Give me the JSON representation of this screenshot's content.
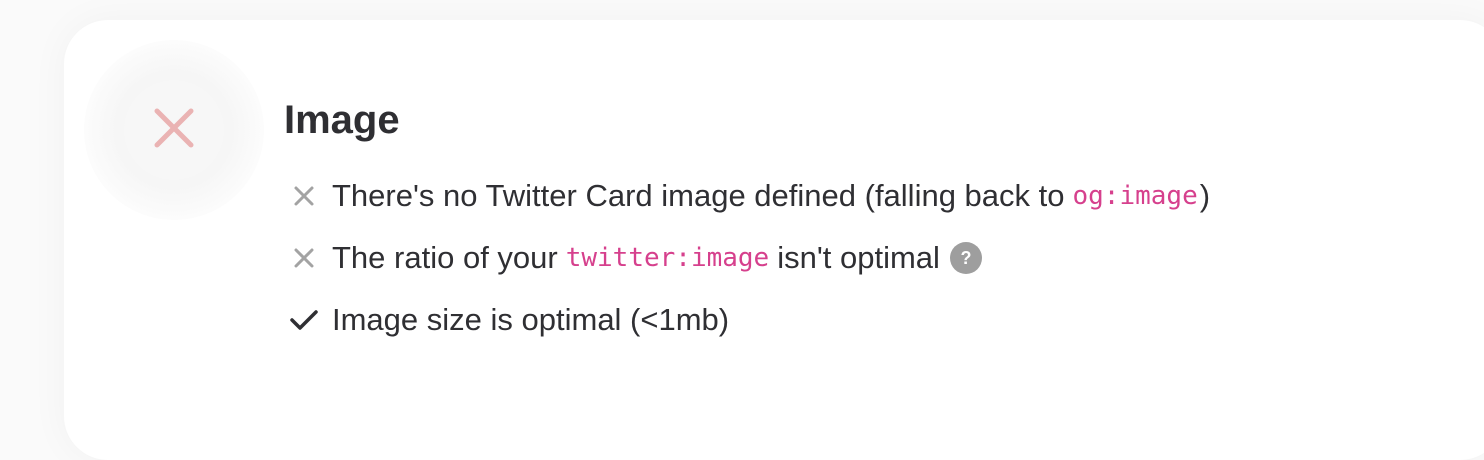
{
  "section": {
    "title": "Image",
    "status": "fail",
    "status_icon": "x-icon",
    "status_color": "#eab3b3"
  },
  "checks": [
    {
      "status": "fail",
      "icon": "x-mark-icon",
      "text_before": "There's no Twitter Card image defined (falling back to",
      "code": "og:image",
      "text_after": ")"
    },
    {
      "status": "fail",
      "icon": "x-mark-icon",
      "text_before": "The ratio of your",
      "code": "twitter:image",
      "text_after": "isn't optimal",
      "help": "?"
    },
    {
      "status": "pass",
      "icon": "check-mark-icon",
      "text": "Image size is optimal (<1mb)"
    }
  ],
  "colors": {
    "fail_mark": "#a3a3a3",
    "pass_mark": "#2f2f33",
    "code": "#d6408d",
    "help_badge": "#9e9e9e"
  }
}
